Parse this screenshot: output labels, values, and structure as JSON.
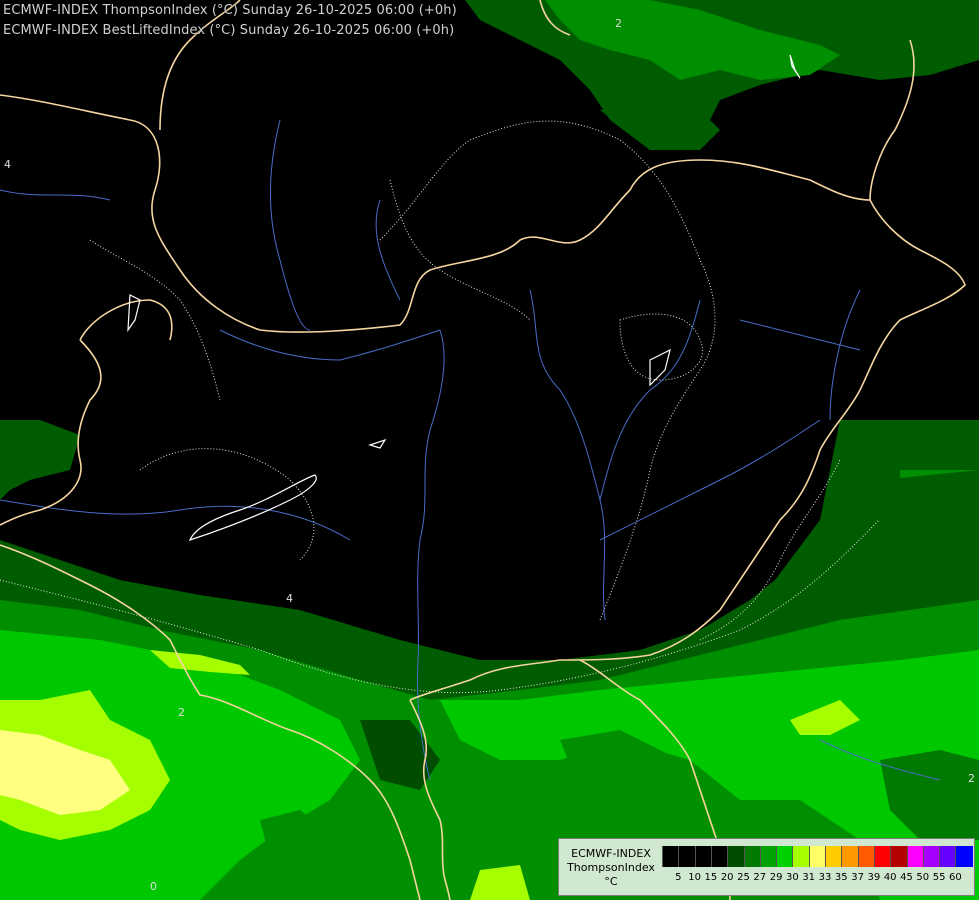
{
  "header": {
    "line1": "ECMWF-INDEX ThompsonIndex (°C) Sunday 26-10-2025 06:00 (+0h)",
    "line2": "ECMWF-INDEX BestLiftedIndex (°C) Sunday 26-10-2025 06:00 (+0h)"
  },
  "legend": {
    "title_line1": "ECMWF-INDEX",
    "title_line2": "ThompsonIndex",
    "unit": "°C",
    "labels": [
      "5",
      "10",
      "15",
      "20",
      "25",
      "27",
      "29",
      "30",
      "31",
      "33",
      "35",
      "37",
      "39",
      "40",
      "45",
      "50",
      "55",
      "60"
    ],
    "colors": [
      "#000000",
      "#000000",
      "#000000",
      "#000000",
      "#004d00",
      "#007a00",
      "#00a400",
      "#00d200",
      "#a6ff00",
      "#ffff66",
      "#ffcc00",
      "#ff9900",
      "#ff5a00",
      "#ff0000",
      "#b40000",
      "#ff00ff",
      "#a600ff",
      "#6600ff",
      "#0000ff"
    ]
  },
  "map": {
    "colors": {
      "background": "#000000",
      "green_dark": "#005c00",
      "green_mid": "#008f00",
      "green_bright": "#00c800",
      "green_lime": "#a6ff00",
      "yellow": "#ffff80",
      "border": "#f5d5a0",
      "river": "#4a6cc8",
      "contour": "#e6e6e6"
    },
    "contour_labels": [
      "2",
      "4",
      "2",
      "4",
      "2",
      "0",
      "2"
    ]
  }
}
